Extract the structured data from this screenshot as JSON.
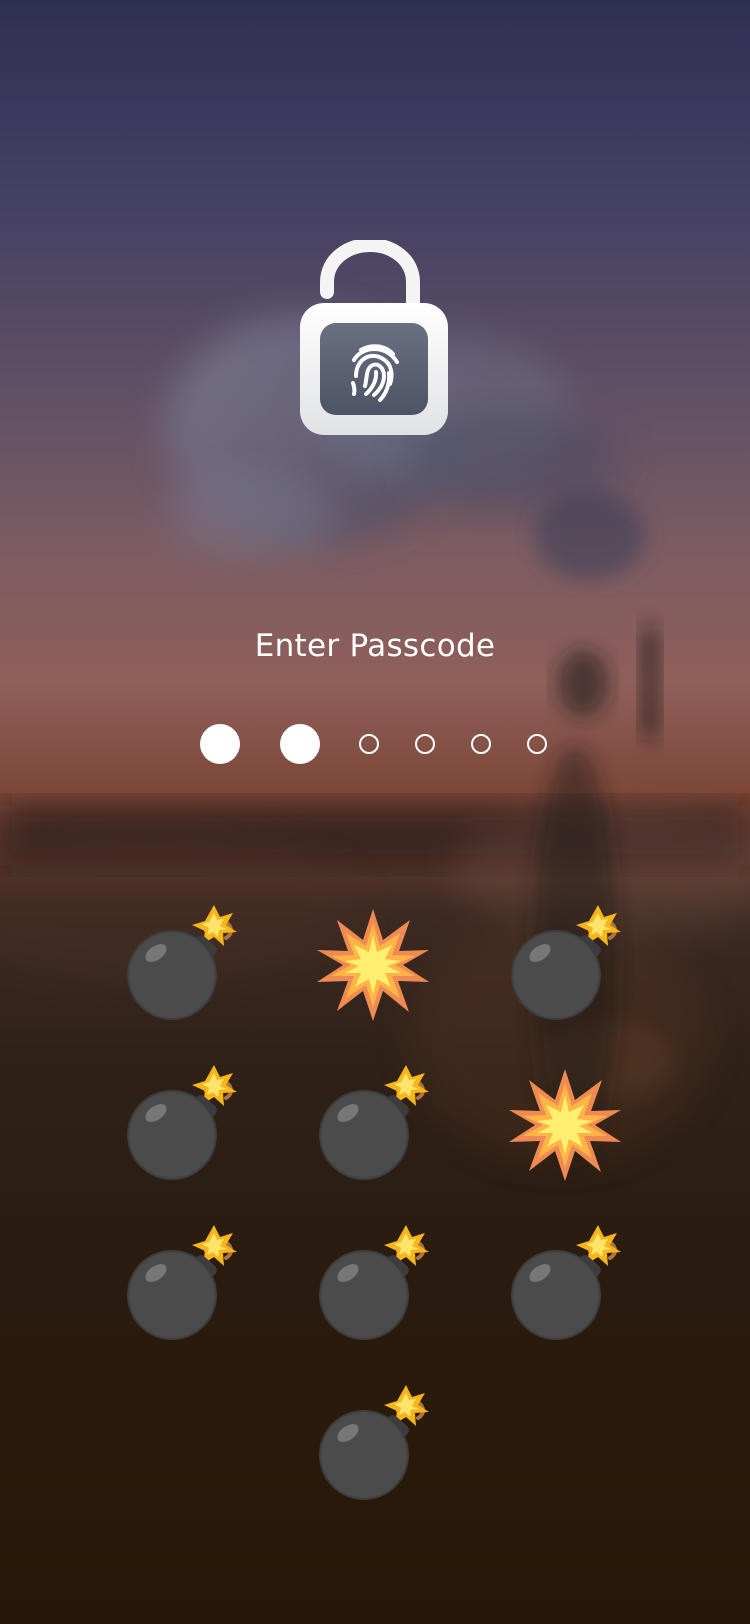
{
  "screen": {
    "title": "Enter Passcode"
  },
  "passcode": {
    "length": 6,
    "entered": 2
  },
  "colors": {
    "text": "#ffffff",
    "lock_body": "#f3f3f3",
    "lock_inner": "#5b6073",
    "bomb_body": "#4a4a4a",
    "fuse": "#b07a3a",
    "spark": "#f7b41d",
    "explosion_outer": "#ef8b53",
    "explosion_inner": "#ffef6b"
  },
  "icons": {
    "lock": "fingerprint-lock-icon",
    "bomb": "bomb-emoji",
    "explosion": "collision-emoji"
  },
  "keypad": {
    "keys": [
      {
        "icon": "bomb"
      },
      {
        "icon": "collision"
      },
      {
        "icon": "bomb"
      },
      {
        "icon": "bomb"
      },
      {
        "icon": "bomb"
      },
      {
        "icon": "collision"
      },
      {
        "icon": "bomb"
      },
      {
        "icon": "bomb"
      },
      {
        "icon": "bomb"
      },
      {
        "icon": "bomb"
      }
    ]
  }
}
